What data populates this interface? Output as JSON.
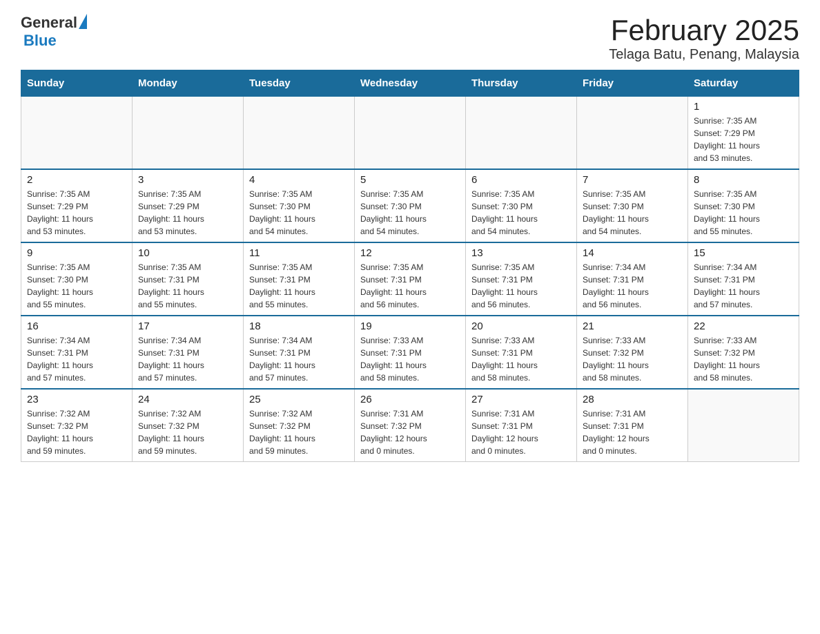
{
  "header": {
    "logo_general": "General",
    "logo_blue": "Blue",
    "month_title": "February 2025",
    "location": "Telaga Batu, Penang, Malaysia"
  },
  "weekdays": [
    "Sunday",
    "Monday",
    "Tuesday",
    "Wednesday",
    "Thursday",
    "Friday",
    "Saturday"
  ],
  "weeks": [
    [
      {
        "day": "",
        "info": ""
      },
      {
        "day": "",
        "info": ""
      },
      {
        "day": "",
        "info": ""
      },
      {
        "day": "",
        "info": ""
      },
      {
        "day": "",
        "info": ""
      },
      {
        "day": "",
        "info": ""
      },
      {
        "day": "1",
        "info": "Sunrise: 7:35 AM\nSunset: 7:29 PM\nDaylight: 11 hours\nand 53 minutes."
      }
    ],
    [
      {
        "day": "2",
        "info": "Sunrise: 7:35 AM\nSunset: 7:29 PM\nDaylight: 11 hours\nand 53 minutes."
      },
      {
        "day": "3",
        "info": "Sunrise: 7:35 AM\nSunset: 7:29 PM\nDaylight: 11 hours\nand 53 minutes."
      },
      {
        "day": "4",
        "info": "Sunrise: 7:35 AM\nSunset: 7:30 PM\nDaylight: 11 hours\nand 54 minutes."
      },
      {
        "day": "5",
        "info": "Sunrise: 7:35 AM\nSunset: 7:30 PM\nDaylight: 11 hours\nand 54 minutes."
      },
      {
        "day": "6",
        "info": "Sunrise: 7:35 AM\nSunset: 7:30 PM\nDaylight: 11 hours\nand 54 minutes."
      },
      {
        "day": "7",
        "info": "Sunrise: 7:35 AM\nSunset: 7:30 PM\nDaylight: 11 hours\nand 54 minutes."
      },
      {
        "day": "8",
        "info": "Sunrise: 7:35 AM\nSunset: 7:30 PM\nDaylight: 11 hours\nand 55 minutes."
      }
    ],
    [
      {
        "day": "9",
        "info": "Sunrise: 7:35 AM\nSunset: 7:30 PM\nDaylight: 11 hours\nand 55 minutes."
      },
      {
        "day": "10",
        "info": "Sunrise: 7:35 AM\nSunset: 7:31 PM\nDaylight: 11 hours\nand 55 minutes."
      },
      {
        "day": "11",
        "info": "Sunrise: 7:35 AM\nSunset: 7:31 PM\nDaylight: 11 hours\nand 55 minutes."
      },
      {
        "day": "12",
        "info": "Sunrise: 7:35 AM\nSunset: 7:31 PM\nDaylight: 11 hours\nand 56 minutes."
      },
      {
        "day": "13",
        "info": "Sunrise: 7:35 AM\nSunset: 7:31 PM\nDaylight: 11 hours\nand 56 minutes."
      },
      {
        "day": "14",
        "info": "Sunrise: 7:34 AM\nSunset: 7:31 PM\nDaylight: 11 hours\nand 56 minutes."
      },
      {
        "day": "15",
        "info": "Sunrise: 7:34 AM\nSunset: 7:31 PM\nDaylight: 11 hours\nand 57 minutes."
      }
    ],
    [
      {
        "day": "16",
        "info": "Sunrise: 7:34 AM\nSunset: 7:31 PM\nDaylight: 11 hours\nand 57 minutes."
      },
      {
        "day": "17",
        "info": "Sunrise: 7:34 AM\nSunset: 7:31 PM\nDaylight: 11 hours\nand 57 minutes."
      },
      {
        "day": "18",
        "info": "Sunrise: 7:34 AM\nSunset: 7:31 PM\nDaylight: 11 hours\nand 57 minutes."
      },
      {
        "day": "19",
        "info": "Sunrise: 7:33 AM\nSunset: 7:31 PM\nDaylight: 11 hours\nand 58 minutes."
      },
      {
        "day": "20",
        "info": "Sunrise: 7:33 AM\nSunset: 7:31 PM\nDaylight: 11 hours\nand 58 minutes."
      },
      {
        "day": "21",
        "info": "Sunrise: 7:33 AM\nSunset: 7:32 PM\nDaylight: 11 hours\nand 58 minutes."
      },
      {
        "day": "22",
        "info": "Sunrise: 7:33 AM\nSunset: 7:32 PM\nDaylight: 11 hours\nand 58 minutes."
      }
    ],
    [
      {
        "day": "23",
        "info": "Sunrise: 7:32 AM\nSunset: 7:32 PM\nDaylight: 11 hours\nand 59 minutes."
      },
      {
        "day": "24",
        "info": "Sunrise: 7:32 AM\nSunset: 7:32 PM\nDaylight: 11 hours\nand 59 minutes."
      },
      {
        "day": "25",
        "info": "Sunrise: 7:32 AM\nSunset: 7:32 PM\nDaylight: 11 hours\nand 59 minutes."
      },
      {
        "day": "26",
        "info": "Sunrise: 7:31 AM\nSunset: 7:32 PM\nDaylight: 12 hours\nand 0 minutes."
      },
      {
        "day": "27",
        "info": "Sunrise: 7:31 AM\nSunset: 7:31 PM\nDaylight: 12 hours\nand 0 minutes."
      },
      {
        "day": "28",
        "info": "Sunrise: 7:31 AM\nSunset: 7:31 PM\nDaylight: 12 hours\nand 0 minutes."
      },
      {
        "day": "",
        "info": ""
      }
    ]
  ]
}
